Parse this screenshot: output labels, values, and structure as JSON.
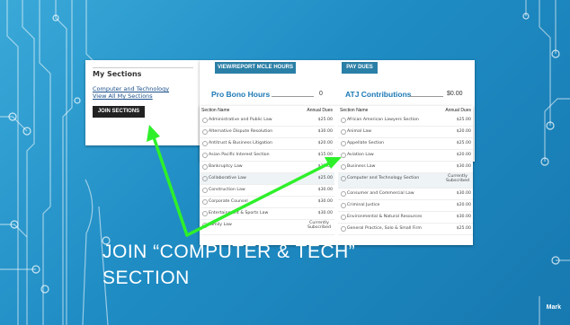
{
  "slide": {
    "caption_line1": "JOIN “COMPUTER & TECH”",
    "caption_line2": "SECTION",
    "footer_label": "Mark",
    "accent_color": "#2ef02a"
  },
  "left_panel": {
    "title": "My Sections",
    "link_1": "Computer and Technology",
    "link_2": "View All My Sections",
    "join_button": "JOIN SECTIONS"
  },
  "top": {
    "mcle_button": "VIEW/REPORT MCLE HOURS",
    "dues_button": "PAY DUES",
    "pro_bono_label": "Pro Bono Hours",
    "pro_bono_value": "0",
    "atj_label": "ATJ Contributions",
    "atj_value": "$0.00"
  },
  "table": {
    "headers": {
      "name": "Section Name",
      "dues": "Annual Dues"
    },
    "left_rows": [
      {
        "name": "Administrative and Public Law",
        "dues": "$25.00"
      },
      {
        "name": "Alternative Dispute Resolution",
        "dues": "$30.00"
      },
      {
        "name": "Antitrust & Business Litigation",
        "dues": "$20.00"
      },
      {
        "name": "Asian Pacific Interest Section",
        "dues": "$15.00"
      },
      {
        "name": "Bankruptcy Law",
        "dues": "$25.00"
      },
      {
        "name": "Collaborative Law",
        "dues": "$25.00"
      },
      {
        "name": "Construction Law",
        "dues": "$30.00"
      },
      {
        "name": "Corporate Counsel",
        "dues": "$30.00"
      },
      {
        "name": "Entertainment & Sports Law",
        "dues": "$30.00"
      },
      {
        "name": "Family Law",
        "dues": "Currently Subscribed"
      }
    ],
    "right_rows": [
      {
        "name": "African American Lawyers Section",
        "dues": "$25.00"
      },
      {
        "name": "Animal Law",
        "dues": "$20.00"
      },
      {
        "name": "Appellate Section",
        "dues": "$25.00"
      },
      {
        "name": "Aviation Law",
        "dues": "$20.00"
      },
      {
        "name": "Business Law",
        "dues": "$30.00"
      },
      {
        "name": "Computer and Technology Section",
        "dues": "Currently Subscribed"
      },
      {
        "name": "Consumer and Commercial Law",
        "dues": "$30.00"
      },
      {
        "name": "Criminal Justice",
        "dues": "$20.00"
      },
      {
        "name": "Environmental & Natural Resources",
        "dues": "$30.00"
      },
      {
        "name": "General Practice, Solo & Small Firm",
        "dues": "$25.00"
      }
    ]
  }
}
